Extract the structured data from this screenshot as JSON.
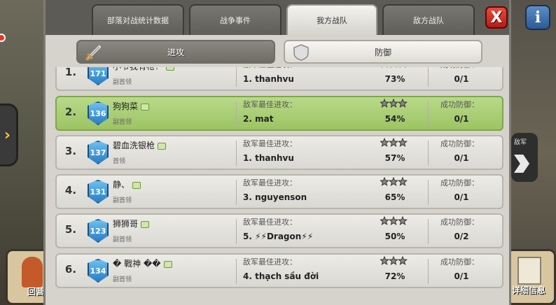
{
  "tabs": [
    {
      "label": "部落对战统计数据",
      "active": false
    },
    {
      "label": "战争事件",
      "active": false
    },
    {
      "label": "我方战队",
      "active": true
    },
    {
      "label": "敌方战队",
      "active": false
    }
  ],
  "close_label": "X",
  "info_label": "i",
  "subtabs": {
    "attack": "进攻",
    "defense": "防御",
    "active": "defense"
  },
  "side": {
    "left_arrow": "›",
    "right_panel_text": "敌军",
    "bottom_left_label": "回营",
    "bottom_right_label": "详细信息"
  },
  "colors": {
    "highlight": "#9cc463",
    "star_filled": "#f0c020",
    "star_empty": "#8a8880"
  },
  "rows": [
    {
      "rank": "1.",
      "level": "171",
      "name": "小爷我有枪！",
      "role": "副首领",
      "attack_label": "敌军最佳进攻：",
      "attacker": "1. thanhvu",
      "stars": 1,
      "percent": "73%",
      "defense_label": "成功防御：",
      "defense": "0/1",
      "highlight": false
    },
    {
      "rank": "2.",
      "level": "136",
      "name": "狗狗菜",
      "role": "副首领",
      "attack_label": "敌军最佳进攻：",
      "attacker": "2. mat",
      "stars": 1,
      "percent": "54%",
      "defense_label": "成功防御：",
      "defense": "0/1",
      "highlight": true
    },
    {
      "rank": "3.",
      "level": "137",
      "name": "碧血洗银枪",
      "role": "首领",
      "attack_label": "敌军最佳进攻：",
      "attacker": "1. thanhvu",
      "stars": 1,
      "percent": "57%",
      "defense_label": "成功防御：",
      "defense": "0/1",
      "highlight": false
    },
    {
      "rank": "4.",
      "level": "131",
      "name": "静、",
      "role": "副首领",
      "attack_label": "敌军最佳进攻：",
      "attacker": "3. nguyenson",
      "stars": 2,
      "percent": "65%",
      "defense_label": "成功防御：",
      "defense": "0/1",
      "highlight": false
    },
    {
      "rank": "5.",
      "level": "123",
      "name": "狮狮哥",
      "role": "副首领",
      "attack_label": "敌军最佳进攻：",
      "attacker": "5. ⚡⚡Dragon⚡⚡",
      "stars": 2,
      "percent": "50%",
      "defense_label": "成功防御：",
      "defense": "0/2",
      "highlight": false
    },
    {
      "rank": "6.",
      "level": "134",
      "name": "� 戰神 ��",
      "role": "副首领",
      "attack_label": "敌军最佳进攻：",
      "attacker": "4. thạch sầu đời",
      "stars": 2,
      "percent": "72%",
      "defense_label": "成功防御：",
      "defense": "0/1",
      "highlight": false
    }
  ]
}
